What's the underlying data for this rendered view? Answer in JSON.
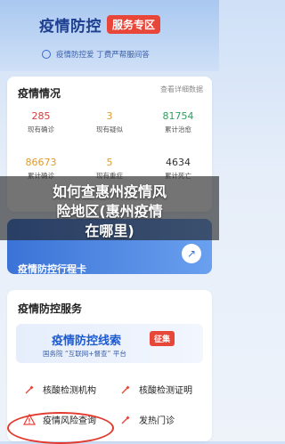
{
  "header": {
    "brand_title": "疫情防控",
    "brand_badge": "服务专区",
    "subtitle": "疫情防控爱 丁费严帮服间答"
  },
  "stats_card": {
    "title": "疫情情况",
    "more_link": "查看详细数据",
    "stats": [
      {
        "value": "285",
        "label": "现有确诊",
        "color": "#d63b3b"
      },
      {
        "value": "3",
        "label": "现有疑似",
        "color": "#e39a28"
      },
      {
        "value": "81754",
        "label": "累计治愈",
        "color": "#29a35a"
      },
      {
        "value": "86673",
        "label": "累计确诊",
        "color": "#e39a28"
      },
      {
        "value": "5",
        "label": "现有重症",
        "color": "#e39a28"
      },
      {
        "value": "4634",
        "label": "累计死亡",
        "color": "#333333"
      }
    ]
  },
  "overlay": {
    "line1": "如何查惠州疫情风",
    "line2": "险地区(惠州疫情",
    "line3": "在哪里)"
  },
  "promo": {
    "title": "疫情防控行程卡",
    "button_glyph": "↗"
  },
  "services_card": {
    "title": "疫情防控服务",
    "banner_title": "疫情防控线索",
    "banner_tag": "征集",
    "banner_sub": "国务院 “互联网+督查” 平台",
    "items": [
      {
        "label": "核酸检测机构",
        "icon": "syringe-icon"
      },
      {
        "label": "核酸检测证明",
        "icon": "syringe-icon"
      },
      {
        "label": "疫情风险查询",
        "icon": "warning-icon"
      },
      {
        "label": "发热门诊",
        "icon": "syringe-icon"
      }
    ]
  }
}
